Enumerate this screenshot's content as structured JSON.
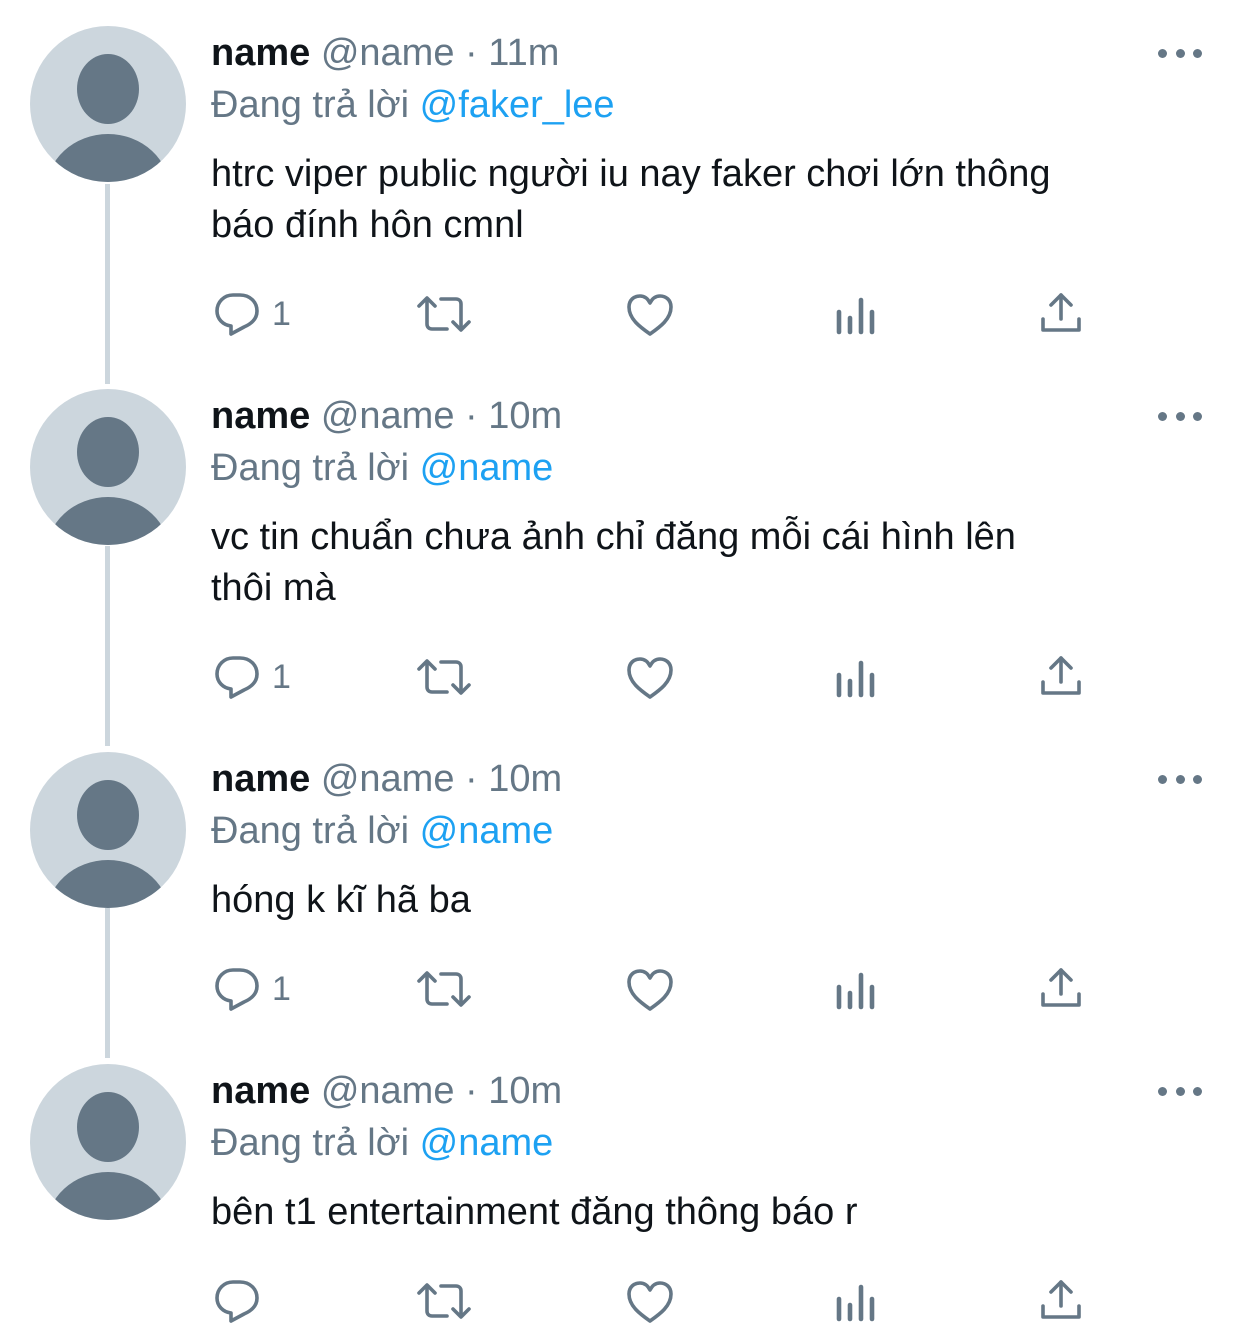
{
  "replying_label": "Đang trả lời",
  "tweets": [
    {
      "display_name": "name",
      "handle": "@name",
      "separator": "·",
      "time": "11m",
      "reply_to": "@faker_lee",
      "text_line1": "htrc viper public người iu nay faker chơi lớn thông",
      "text_line2": "báo đính hôn cmnl",
      "reply_count": "1"
    },
    {
      "display_name": "name",
      "handle": "@name",
      "separator": "·",
      "time": "10m",
      "reply_to": "@name",
      "text_line1": "vc tin chuẩn chưa ảnh chỉ đăng mỗi cái hình lên",
      "text_line2": "thôi mà",
      "reply_count": "1"
    },
    {
      "display_name": "name",
      "handle": "@name",
      "separator": "·",
      "time": "10m",
      "reply_to": "@name",
      "text_line1": "hóng k kĩ hã ba",
      "text_line2": "",
      "reply_count": "1"
    },
    {
      "display_name": "name",
      "handle": "@name",
      "separator": "·",
      "time": "10m",
      "reply_to": "@name",
      "text_line1": "bên t1 entertainment đăng thông báo r",
      "text_line2": "",
      "reply_count": ""
    }
  ],
  "icons": {
    "reply": "reply-icon",
    "retweet": "retweet-icon",
    "like": "heart-icon",
    "analytics": "analytics-icon",
    "share": "share-icon",
    "more": "more-icon"
  },
  "colors": {
    "text": "#0f1419",
    "secondary": "#657786",
    "link": "#1da1f2",
    "avatar_bg": "#ccd6dd",
    "avatar_fg": "#657786"
  }
}
